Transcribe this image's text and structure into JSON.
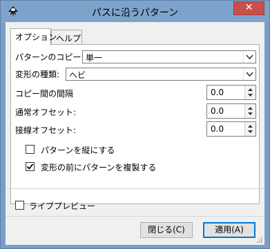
{
  "window": {
    "title": "パスに沿うパターン",
    "close_glyph": "✕"
  },
  "tabs": [
    {
      "label": "オプション"
    },
    {
      "label": "ヘルプ"
    }
  ],
  "options": {
    "pattern_copy": {
      "label": "パターンのコピー:",
      "value": "単一"
    },
    "transform_type": {
      "label": "変形の種類:",
      "value": "ヘビ"
    },
    "copy_spacing": {
      "label": "コピー間の間隔",
      "value": "0.0"
    },
    "normal_offset": {
      "label": "通常オフセット:",
      "value": "0.0"
    },
    "tangential_offset": {
      "label": "接線オフセット:",
      "value": "0.0"
    },
    "pattern_vertical": {
      "label": "パターンを縦にする",
      "checked": false
    },
    "duplicate_before_transform": {
      "label": "変形の前にパターンを複製する",
      "checked": true
    }
  },
  "live_preview": {
    "label": "ライブプレビュー",
    "checked": false
  },
  "buttons": {
    "close": "閉じる(C)",
    "apply": "適用(A)"
  },
  "icons": {
    "app": "inkscape-icon",
    "dropdown": "chevron-down-icon",
    "spin": "spin-arrows-icon"
  }
}
